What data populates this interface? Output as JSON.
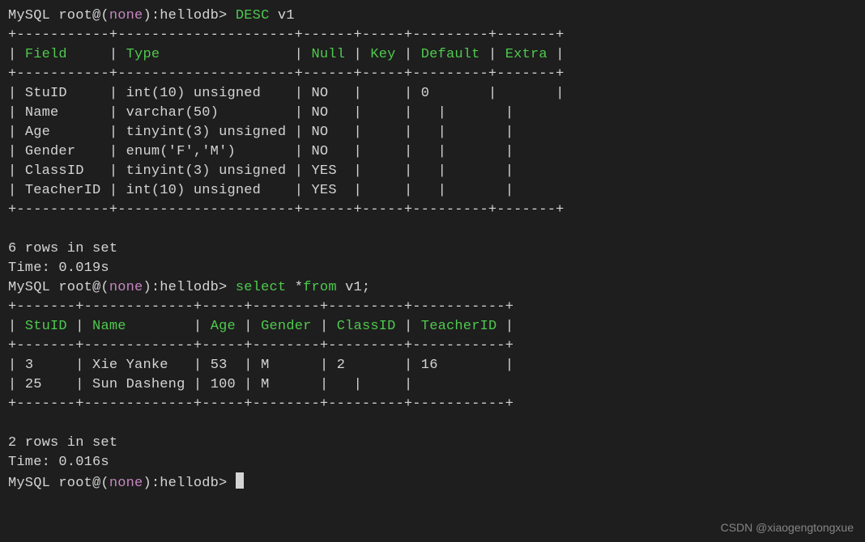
{
  "prompt": {
    "prefix": "MySQL root@(",
    "none": "none",
    "suffix": "):hellodb>"
  },
  "commands": {
    "desc": {
      "kw": "DESC",
      "arg": " v1"
    },
    "select": {
      "kw1": "select",
      "kw2": "from",
      "arg": " *",
      "arg2": " v1;"
    }
  },
  "table1": {
    "border_top": "+-----------+---------------------+------+-----+---------+-------+",
    "header": {
      "c1": "Field",
      "c2": "Type",
      "c3": "Null",
      "c4": "Key",
      "c5": "Default",
      "c6": "Extra"
    },
    "border_mid": "+-----------+---------------------+------+-----+---------+-------+",
    "rows": [
      {
        "c1": "StuID",
        "c2": "int(10) unsigned",
        "c3": "NO",
        "c4": "",
        "c5": "0",
        "c5_null": false,
        "c6": ""
      },
      {
        "c1": "Name",
        "c2": "varchar(50)",
        "c3": "NO",
        "c4": "",
        "c5": "<null>",
        "c5_null": true,
        "c6": ""
      },
      {
        "c1": "Age",
        "c2": "tinyint(3) unsigned",
        "c3": "NO",
        "c4": "",
        "c5": "<null>",
        "c5_null": true,
        "c6": ""
      },
      {
        "c1": "Gender",
        "c2": "enum('F','M')",
        "c3": "NO",
        "c4": "",
        "c5": "<null>",
        "c5_null": true,
        "c6": ""
      },
      {
        "c1": "ClassID",
        "c2": "tinyint(3) unsigned",
        "c3": "YES",
        "c4": "",
        "c5": "<null>",
        "c5_null": true,
        "c6": ""
      },
      {
        "c1": "TeacherID",
        "c2": "int(10) unsigned",
        "c3": "YES",
        "c4": "",
        "c5": "<null>",
        "c5_null": true,
        "c6": ""
      }
    ],
    "border_bot": "+-----------+---------------------+------+-----+---------+-------+"
  },
  "result1": {
    "rows": "6 rows in set",
    "time": "Time: 0.019s"
  },
  "table2": {
    "border_top": "+-------+-------------+-----+--------+---------+-----------+",
    "header": {
      "c1": "StuID",
      "c2": "Name",
      "c3": "Age",
      "c4": "Gender",
      "c5": "ClassID",
      "c6": "TeacherID"
    },
    "border_mid": "+-------+-------------+-----+--------+---------+-----------+",
    "rows": [
      {
        "c1": "3",
        "c2": "Xie Yanke",
        "c3": "53",
        "c4": "M",
        "c5": "2",
        "c5_null": false,
        "c6": "16",
        "c6_null": false
      },
      {
        "c1": "25",
        "c2": "Sun Dasheng",
        "c3": "100",
        "c4": "M",
        "c5": "<null>",
        "c5_null": true,
        "c6": "<null>",
        "c6_null": true
      }
    ],
    "border_bot": "+-------+-------------+-----+--------+---------+-----------+"
  },
  "result2": {
    "rows": "2 rows in set",
    "time": "Time: 0.016s"
  },
  "watermark": "CSDN @xiaogengtongxue"
}
